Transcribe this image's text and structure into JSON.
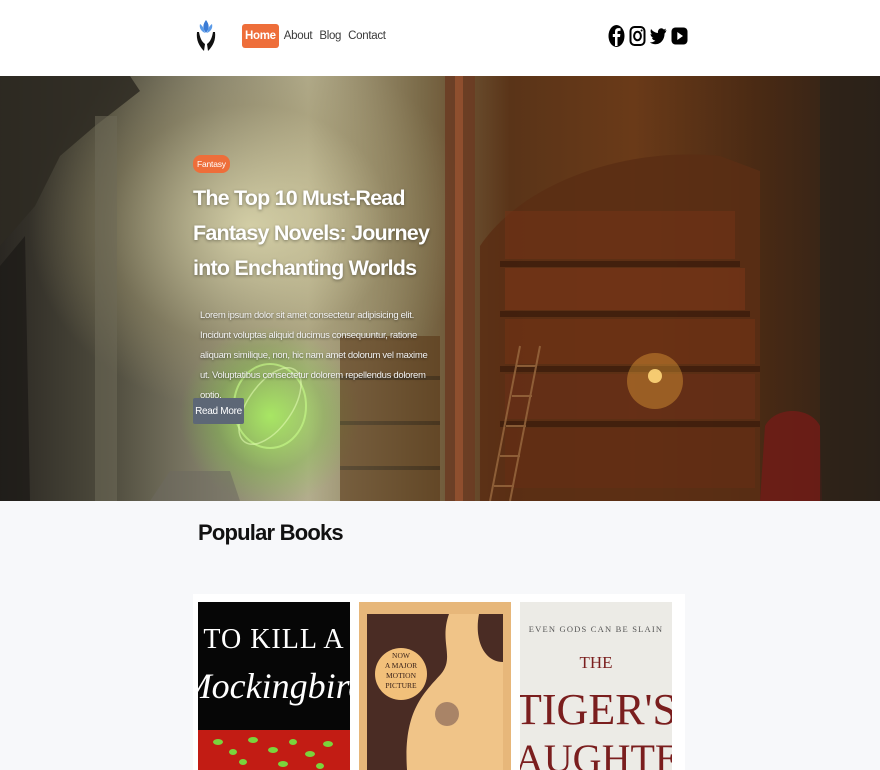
{
  "header": {
    "logo": "hand-lotus-logo",
    "nav": [
      {
        "label": "Home",
        "active": true
      },
      {
        "label": "About",
        "active": false
      },
      {
        "label": "Blog",
        "active": false
      },
      {
        "label": "Contact",
        "active": false
      }
    ],
    "socials": [
      "facebook-icon",
      "instagram-icon",
      "twitter-icon",
      "youtube-icon"
    ]
  },
  "hero": {
    "tag": "Fantasy",
    "title": "The Top 10 Must-Read Fantasy Novels: Journey into Enchanting Worlds",
    "text": "Lorem ipsum dolor sit amet consectetur adipisicing elit. Incidunt voluptas aliquid ducimus consequuntur, ratione aliquam similique, non, hic nam amet dolorum vel maxime ut. Voluptatibus consectetur dolorem repellendus dolorem optio.",
    "button": "Read More"
  },
  "popular": {
    "title": "Popular Books",
    "books": [
      {
        "cover_line1": "TO KILL A",
        "cover_line2": "Mockingbird"
      },
      {
        "badge": "NOW A MAJOR MOTION PICTURE"
      },
      {
        "tagline": "EVEN GODS CAN BE SLAIN",
        "cover_line1": "THE",
        "cover_line2": "TIGER'S",
        "cover_line3": "DAUGHTER"
      }
    ]
  },
  "colors": {
    "accent": "#ee6e3a",
    "button": "#5d6776"
  }
}
